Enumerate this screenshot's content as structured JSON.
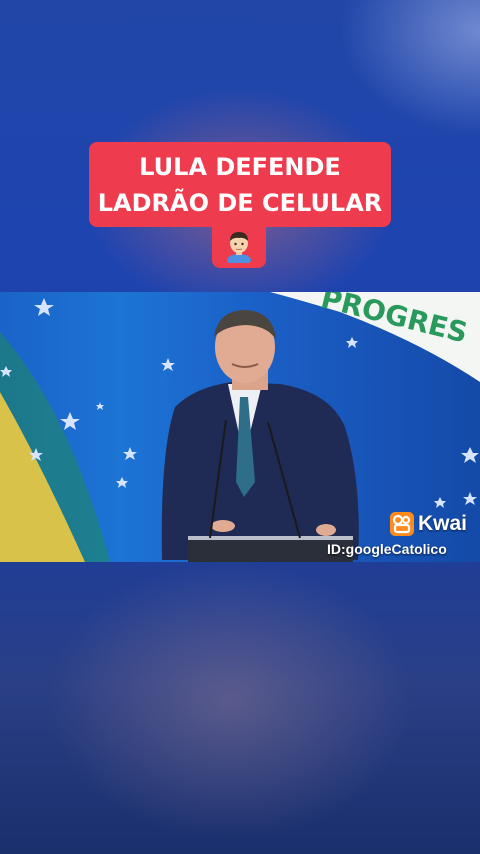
{
  "overlay": {
    "title_line1": "LULA DEFENDE",
    "title_line2": "LADRÃO DE CELULAR",
    "emoji": "man-emoji",
    "accent_color": "#ee3b4d"
  },
  "video": {
    "banner_text": "PROGRES",
    "watermark_brand": "Kwai",
    "watermark_id": "ID:googleCatolico",
    "brand_color": "#ff8a1d"
  }
}
